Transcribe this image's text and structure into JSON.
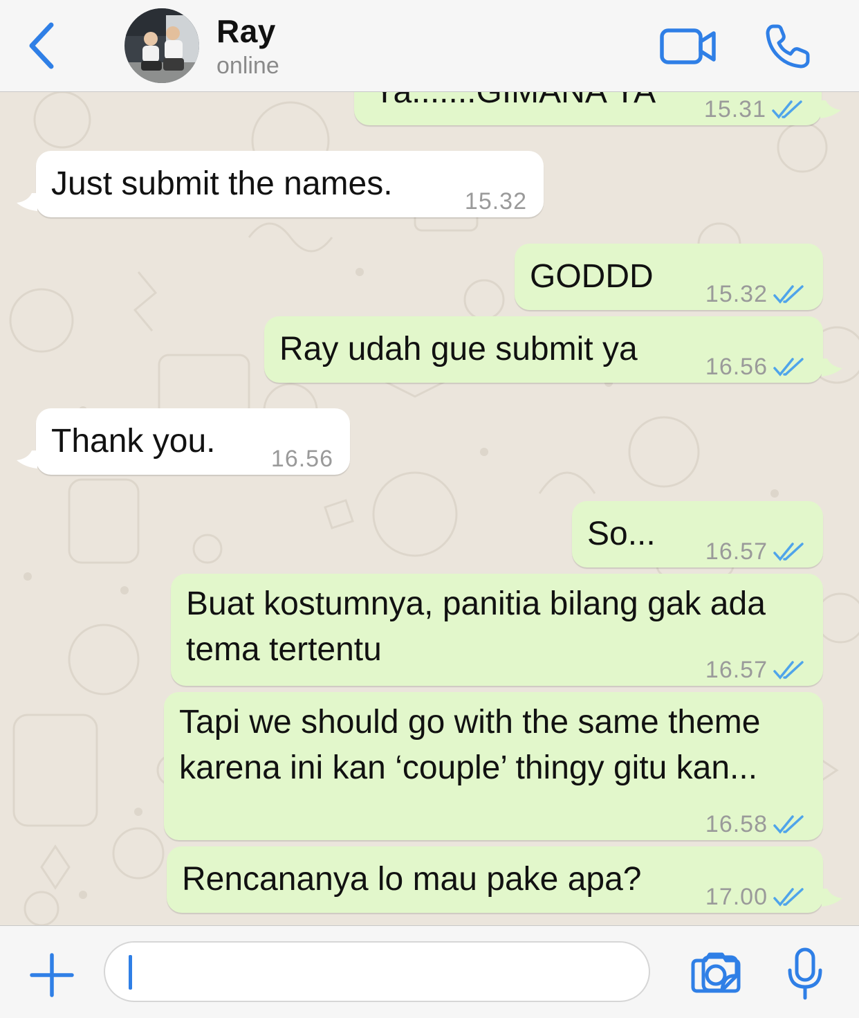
{
  "header": {
    "contact_name": "Ray",
    "contact_status": "online",
    "back_icon": "chevron-left-icon",
    "video_icon": "video-camera-icon",
    "phone_icon": "phone-icon"
  },
  "colors": {
    "accent": "#2f7fe6",
    "incoming_bubble": "#ffffff",
    "outgoing_bubble": "#e2f7cb",
    "read_ticks": "#4fa4ea",
    "wallpaper": "#ebe5dc"
  },
  "messages": [
    {
      "direction": "out",
      "text": "Ya.......GIMANA YA",
      "time": "15.31",
      "read": true
    },
    {
      "direction": "in",
      "text": "Just submit the names.",
      "time": "15.32"
    },
    {
      "direction": "out",
      "text": "GODDD",
      "time": "15.32",
      "read": true
    },
    {
      "direction": "out",
      "text": "Ray udah gue submit ya",
      "time": "16.56",
      "read": true
    },
    {
      "direction": "in",
      "text": "Thank you.",
      "time": "16.56"
    },
    {
      "direction": "out",
      "text": "So...",
      "time": "16.57",
      "read": true
    },
    {
      "direction": "out",
      "lines": [
        "Buat kostumnya, panitia bilang gak ada",
        "tema tertentu"
      ],
      "time": "16.57",
      "read": true
    },
    {
      "direction": "out",
      "lines": [
        "Tapi we should go with the same theme",
        "karena ini kan ‘couple’ thingy gitu kan..."
      ],
      "time": "16.58",
      "read": true
    },
    {
      "direction": "out",
      "text": "Rencananya lo mau pake apa?",
      "time": "17.00",
      "read": true
    }
  ],
  "input": {
    "value": "",
    "plus_icon": "plus-icon",
    "sticker_icon": "sticker-icon",
    "camera_icon": "camera-icon",
    "mic_icon": "microphone-icon"
  }
}
